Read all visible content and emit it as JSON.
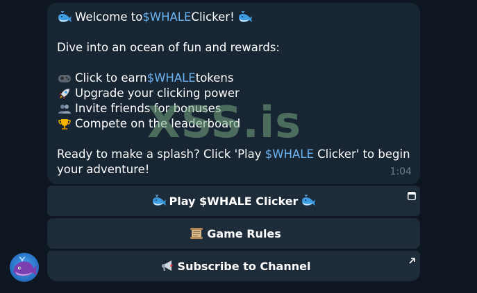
{
  "message": {
    "line1_before": "Welcome to ",
    "line1_ticker": "$WHALE",
    "line1_after": " Clicker!",
    "line2": "Dive into an ocean of fun and rewards:",
    "bullets": [
      {
        "icon": "gamepad-icon",
        "before": "Click to earn ",
        "ticker": "$WHALE",
        "after": " tokens"
      },
      {
        "icon": "rocket-icon",
        "before": "Upgrade your clicking power",
        "ticker": "",
        "after": ""
      },
      {
        "icon": "people-icon",
        "before": "Invite friends for bonuses",
        "ticker": "",
        "after": ""
      },
      {
        "icon": "trophy-icon",
        "before": "Compete on the leaderboard",
        "ticker": "",
        "after": ""
      }
    ],
    "outro_before": "Ready to make a splash? Click 'Play ",
    "outro_ticker": "$WHALE",
    "outro_after": " Clicker' to begin your adventure!",
    "time": "1:04"
  },
  "watermark": "XSS.is",
  "buttons": [
    {
      "label": "Play $WHALE Clicker",
      "icon": "whale-icon",
      "corner": "webapp-icon"
    },
    {
      "label": "Game Rules",
      "icon": "scroll-icon",
      "corner": ""
    },
    {
      "label": "Subscribe to Channel",
      "icon": "megaphone-icon",
      "corner": "external-link-icon"
    }
  ],
  "colors": {
    "background": "#0e1621",
    "bubble": "#182533",
    "button": "#1e2c3a",
    "ticker": "#6ab3f3",
    "time": "#6d7f8f"
  }
}
